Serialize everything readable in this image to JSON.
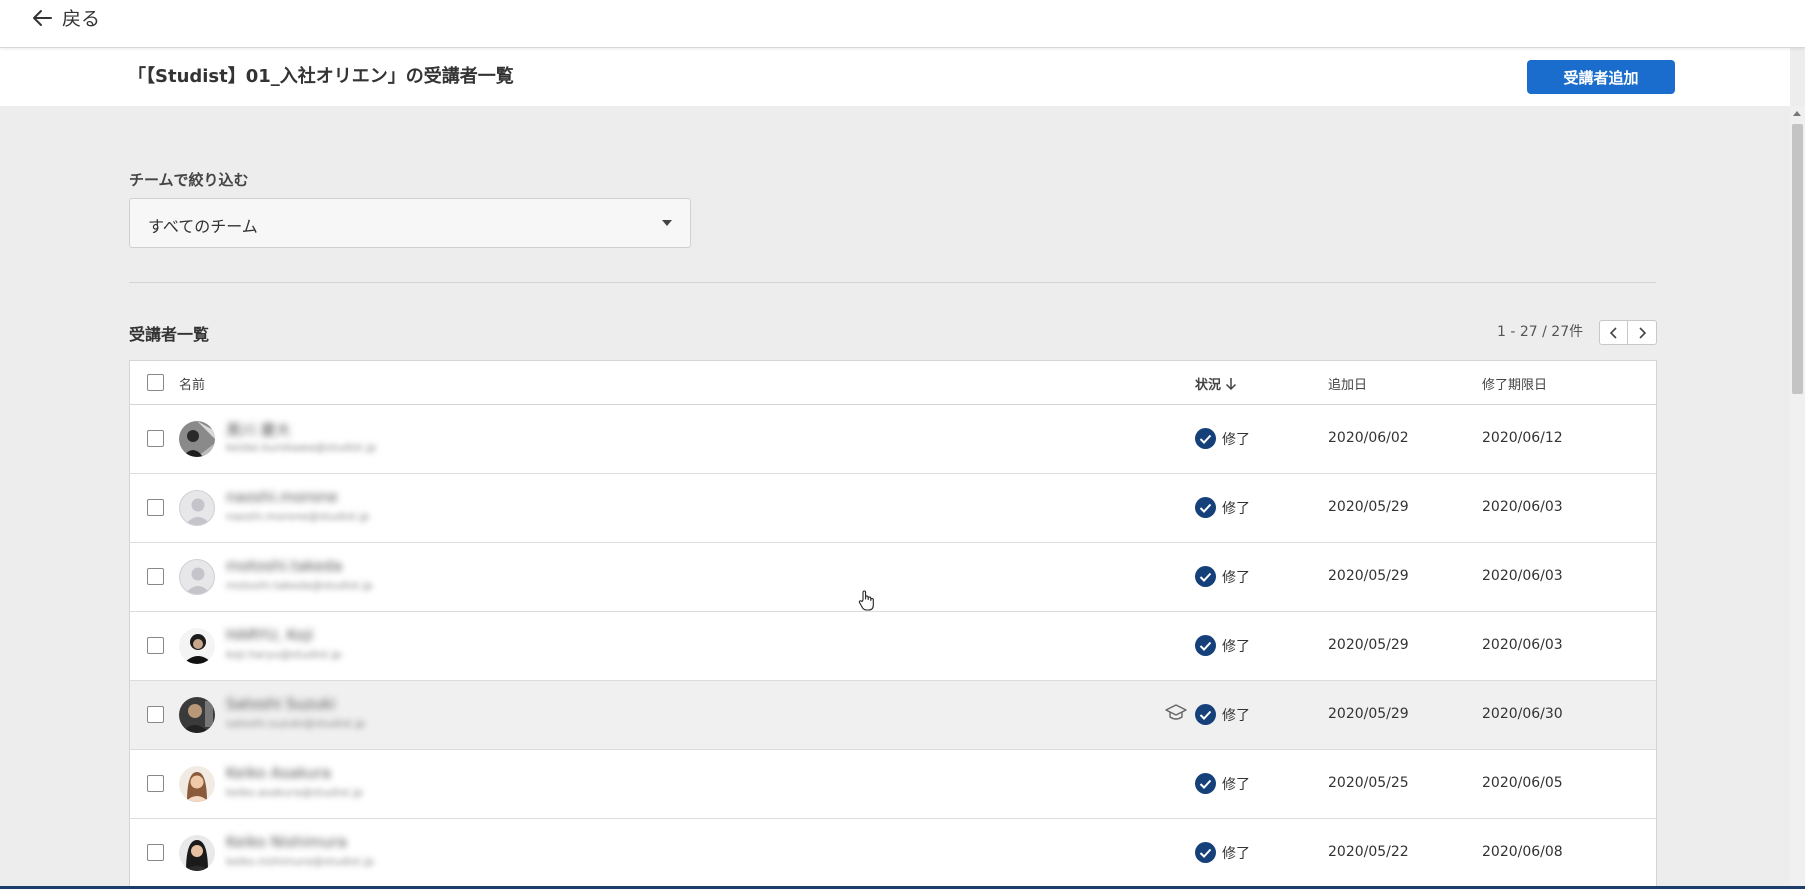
{
  "topbar": {
    "back_label": "戻る"
  },
  "header": {
    "title": "「【Studist】01_入社オリエン」の受講者一覧",
    "add_button": "受講者追加"
  },
  "filter": {
    "label": "チームで絞り込む",
    "selected": "すべてのチーム"
  },
  "list": {
    "title": "受講者一覧",
    "paging": "1 - 27 / 27件",
    "columns": {
      "name": "名前",
      "status": "状況",
      "added": "追加日",
      "deadline": "修了期限日"
    },
    "rows": [
      {
        "name": "黒川 慶大",
        "email": "keidai.kurokawa@studist.jp",
        "status": "修了",
        "added": "2020/06/02",
        "deadline": "2020/06/12"
      },
      {
        "name": "naoshi.morone",
        "email": "naoshi.morone@studist.jp",
        "status": "修了",
        "added": "2020/05/29",
        "deadline": "2020/06/03"
      },
      {
        "name": "motoshi.takeda",
        "email": "motoshi.takeda@studist.jp",
        "status": "修了",
        "added": "2020/05/29",
        "deadline": "2020/06/03"
      },
      {
        "name": "HARYU, Koji",
        "email": "koji.haryu@studist.jp",
        "status": "修了",
        "added": "2020/05/29",
        "deadline": "2020/06/03"
      },
      {
        "name": "Satoshi Suzuki",
        "email": "satoshi.suzuki@studist.jp",
        "status": "修了",
        "added": "2020/05/29",
        "deadline": "2020/06/30"
      },
      {
        "name": "Keiko Asakura",
        "email": "keiko.asakura@studist.jp",
        "status": "修了",
        "added": "2020/05/25",
        "deadline": "2020/06/05"
      },
      {
        "name": "Keiko Nishimura",
        "email": "keiko.nishimura@studist.jp",
        "status": "修了",
        "added": "2020/05/22",
        "deadline": "2020/06/08"
      }
    ]
  },
  "colors": {
    "primary": "#1a6dcc",
    "check": "#15407a",
    "background": "#ededee"
  }
}
